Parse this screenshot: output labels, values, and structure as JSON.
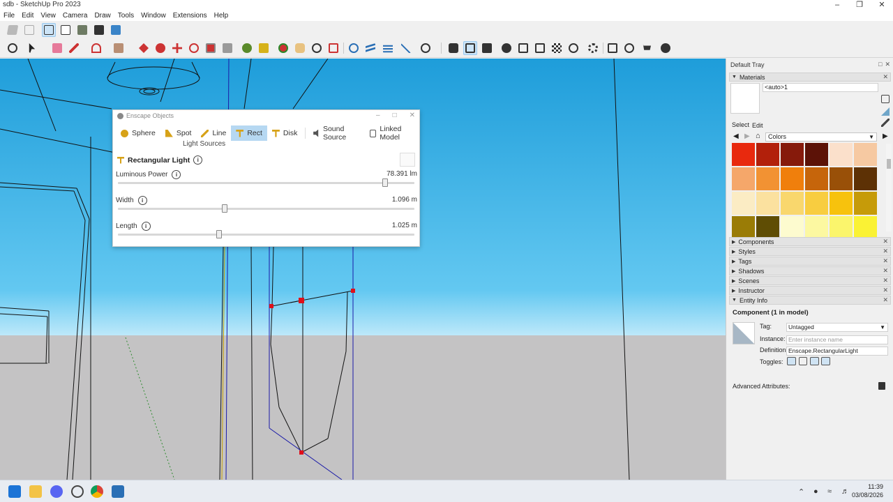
{
  "window": {
    "title": "sdb - SketchUp Pro 2023"
  },
  "menu": [
    "File",
    "Edit",
    "View",
    "Camera",
    "Draw",
    "Tools",
    "Window",
    "Extensions",
    "Help"
  ],
  "enscape": {
    "title": "Enscape Objects",
    "tabs": [
      {
        "label": "Sphere",
        "icon": "sphere-icon"
      },
      {
        "label": "Spot",
        "icon": "spot-icon"
      },
      {
        "label": "Line",
        "icon": "line-icon"
      },
      {
        "label": "Rect",
        "icon": "rect-light-icon",
        "active": true
      },
      {
        "label": "Disk",
        "icon": "disk-icon"
      },
      {
        "label": "Sound Source",
        "icon": "speaker-icon"
      },
      {
        "label": "Linked Model",
        "icon": "linked-model-icon"
      }
    ],
    "group_label": "Light Sources",
    "heading": "Rectangular Light",
    "sliders": [
      {
        "label": "Luminous Power",
        "value": "78.391 lm",
        "level": 0.9
      },
      {
        "label": "Width",
        "value": "1.096 m",
        "level": 0.36
      },
      {
        "label": "Length",
        "value": "1.025 m",
        "level": 0.34
      }
    ]
  },
  "tray": {
    "title": "Default Tray",
    "materials_label": "Materials",
    "material_name": "<auto>1",
    "select_tab": "Select",
    "edit_tab": "Edit",
    "library": "Colors",
    "swatches": [
      "#e8290e",
      "#b2200b",
      "#861a0b",
      "#5c1207",
      "#fbe0cb",
      "#f6c9a2",
      "#f5a76a",
      "#f29233",
      "#f07f0c",
      "#c6650b",
      "#995008",
      "#5d3105",
      "#fbecc4",
      "#fbe19f",
      "#f9d76d",
      "#f8cd40",
      "#f7c20d",
      "#c69b09",
      "#9a7c06",
      "#5f4d04",
      "#fdfbcf",
      "#fcf8a1",
      "#fbf56c",
      "#faf234"
    ],
    "panels": [
      "Components",
      "Styles",
      "Tags",
      "Shadows",
      "Scenes",
      "Instructor",
      "Entity Info"
    ],
    "entity_info": {
      "title": "Component (1 in model)",
      "tag_label": "Tag:",
      "tag_value": "Untagged",
      "instance_label": "Instance:",
      "instance_placeholder": "Enter instance name",
      "definition_label": "Definition:",
      "definition_value": "Enscape.RectangularLight",
      "toggles_label": "Toggles:",
      "advanced_label": "Advanced Attributes:"
    }
  },
  "taskbar": {
    "time": "11:39",
    "date": "03/08/2026"
  }
}
